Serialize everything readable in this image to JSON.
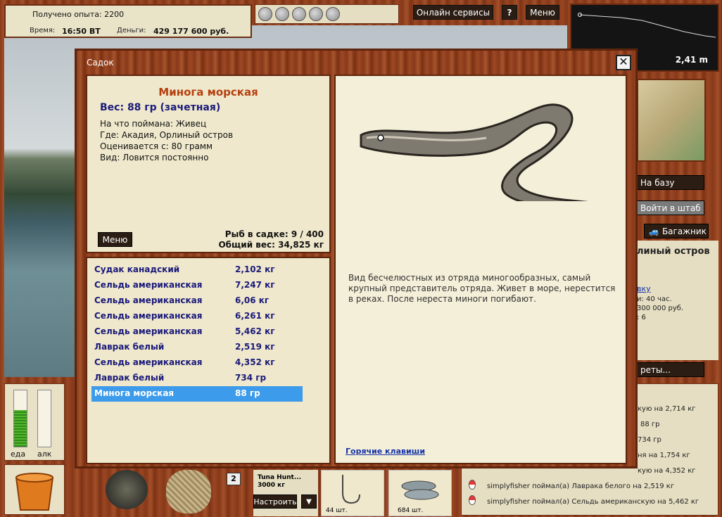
{
  "hud": {
    "xp_text": "Получено опыта: 2200",
    "time_label": "Время:",
    "time_value": "16:50 ВТ",
    "money_label": "Деньги:",
    "money_value": "429 177 600 руб."
  },
  "top_buttons": {
    "online": "Онлайн сервисы",
    "help": "?",
    "menu": "Меню"
  },
  "depth": {
    "value": "2,41 m"
  },
  "side_buttons": {
    "base": "На базу",
    "hq": "Войти в штаб",
    "trunk": "Багажник",
    "secrets": "реты..."
  },
  "right_info": {
    "location": "линый остров",
    "link": "вку",
    "l1": "и: 40 час.",
    "l2": "300 000 руб.",
    "l3": "​: 6"
  },
  "gauges": {
    "food_label": "еда",
    "alc_label": "алк",
    "food_fill": 0.65,
    "alc_fill": 0.0
  },
  "dialog": {
    "title": "Садок",
    "close": "✕",
    "fish": {
      "name": "Минога морская",
      "weight": "Вес: 88 гр (зачетная)",
      "bait": "На что поймана: Живец",
      "where": "Где: Акадия, Орлиный остров",
      "rated": "Оценивается с: 80 грамм",
      "kind": "Вид: Ловится постоянно",
      "description": "Вид бесчелюстных из отряда миногообразных, самый крупный представитель отряда. Живет в море, нерестится в реках. После нереста миноги погибают."
    },
    "menu_button": "Меню",
    "fish_count": "Рыб в садке: 9 / 400",
    "total_weight": "Общий вес: 34,825 кг",
    "hotkeys": "Горячие клавиши",
    "catch": [
      {
        "name": "Судак канадский",
        "weight": "2,102 кг"
      },
      {
        "name": "Сельдь американская",
        "weight": "7,247 кг"
      },
      {
        "name": "Сельдь американская",
        "weight": "6,06 кг"
      },
      {
        "name": "Сельдь американская",
        "weight": "6,261 кг"
      },
      {
        "name": "Сельдь американская",
        "weight": "5,462 кг"
      },
      {
        "name": "Лаврак белый",
        "weight": "2,519 кг"
      },
      {
        "name": "Сельдь американская",
        "weight": "4,352 кг"
      },
      {
        "name": "Лаврак белый",
        "weight": "734 гр"
      },
      {
        "name": "Минога морская",
        "weight": "88 гр"
      }
    ]
  },
  "bottom": {
    "slot_number": "2",
    "tackle_name": "Tuna Hunt...",
    "tackle_weight": "3000 кг",
    "setup_button": "Настроить",
    "dropdown": "▼",
    "item1_count": "44 шт.",
    "item2_count": "684 шт."
  },
  "feed": [
    "кую на 2,714 кг",
    "88 гр",
    "734 гр",
    "ня на 1,754 кг",
    "кую на 4,352 кг",
    "simplyfisher поймал(а) Лаврака белого на 2,519 кг",
    "simplyfisher поймал(а) Сельдь американскую на 5,462 кг"
  ]
}
